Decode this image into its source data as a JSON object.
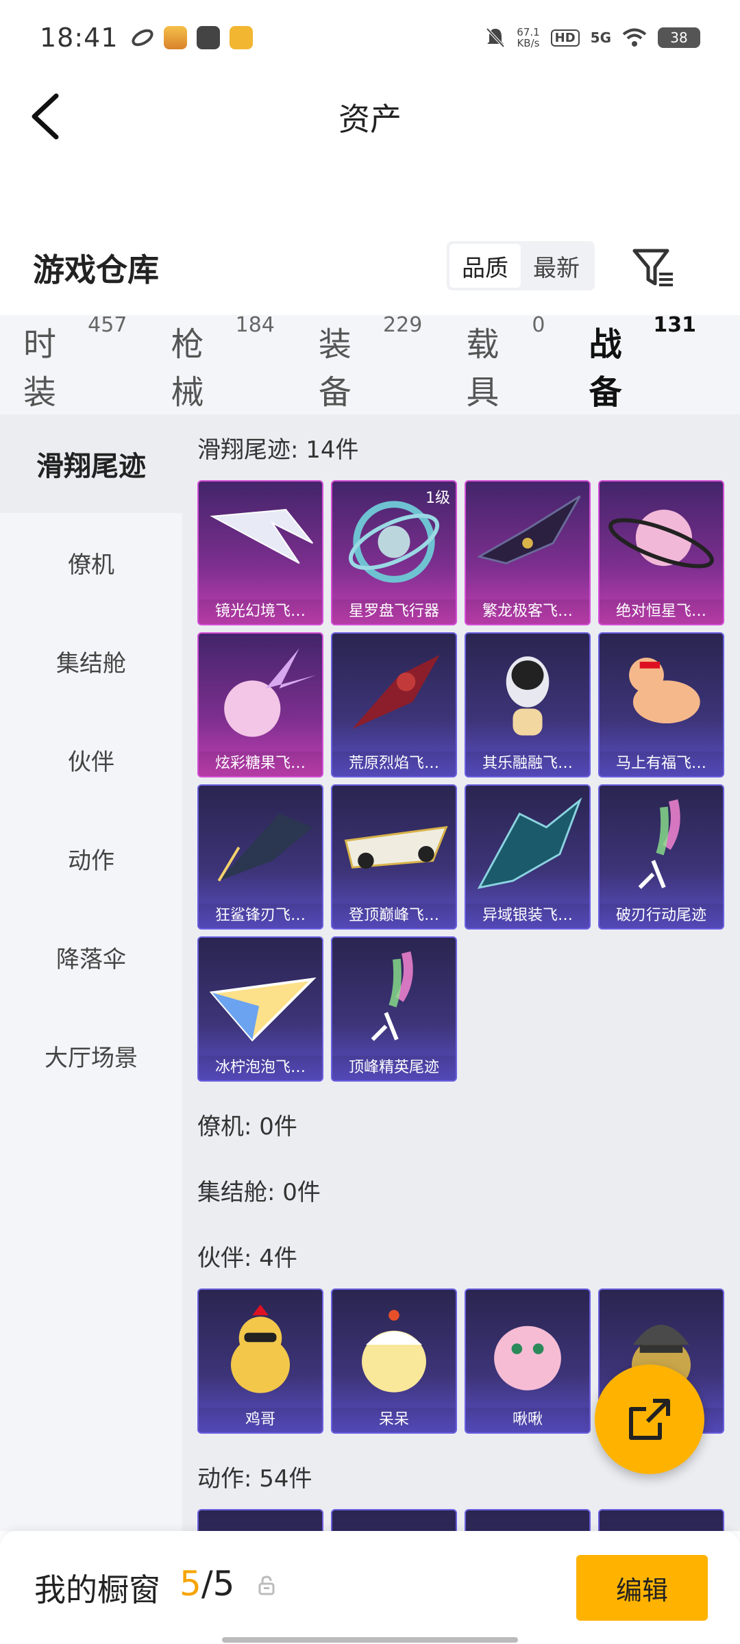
{
  "status": {
    "time": "18:41",
    "net_speed_value": "67.1",
    "net_speed_unit": "KB/s",
    "hd": "HD",
    "signal": "5G",
    "battery": "38"
  },
  "header": {
    "title": "资产"
  },
  "warehouse": {
    "title": "游戏仓库",
    "sort": {
      "quality": "品质",
      "newest": "最新",
      "active": "quality"
    }
  },
  "tabs": [
    {
      "label": "时装",
      "count": "457"
    },
    {
      "label": "枪械",
      "count": "184"
    },
    {
      "label": "装备",
      "count": "229"
    },
    {
      "label": "载具",
      "count": "0"
    },
    {
      "label": "战备",
      "count": "131",
      "active": true
    }
  ],
  "sidebar": {
    "items": [
      "滑翔尾迹",
      "僚机",
      "集结舱",
      "伙伴",
      "动作",
      "降落伞",
      "大厅场景"
    ],
    "active_index": 0
  },
  "sections": {
    "glide": {
      "title": "滑翔尾迹: 14件",
      "items": [
        {
          "name": "镜光幻境飞…",
          "tier": "pink",
          "icon": "crystal-wings-icon"
        },
        {
          "name": "星罗盘飞行器",
          "tier": "pink",
          "icon": "astrolabe-icon",
          "level": "1级"
        },
        {
          "name": "繁龙极客飞…",
          "tier": "pink",
          "icon": "dragon-glider-icon"
        },
        {
          "name": "绝对恒星飞…",
          "tier": "pink",
          "icon": "planet-icon"
        },
        {
          "name": "炫彩糖果飞…",
          "tier": "pink",
          "icon": "candy-icon"
        },
        {
          "name": "荒原烈焰飞…",
          "tier": "purple",
          "icon": "flame-glider-icon"
        },
        {
          "name": "其乐融融飞…",
          "tier": "purple",
          "icon": "penguin-icon"
        },
        {
          "name": "马上有福飞…",
          "tier": "purple",
          "icon": "horse-icon"
        },
        {
          "name": "狂鲨锋刃飞…",
          "tier": "purple",
          "icon": "shark-icon"
        },
        {
          "name": "登顶巅峰飞…",
          "tier": "purple",
          "icon": "jet-icon"
        },
        {
          "name": "异域银装飞…",
          "tier": "purple",
          "icon": "bat-wing-icon"
        },
        {
          "name": "破刃行动尾迹",
          "tier": "purple",
          "icon": "smoke-trail-icon"
        },
        {
          "name": "冰柠泡泡飞…",
          "tier": "purple",
          "icon": "paper-plane-icon"
        },
        {
          "name": "顶峰精英尾迹",
          "tier": "purple",
          "icon": "smoke-trail-icon"
        }
      ]
    },
    "wingman": {
      "title": "僚机: 0件"
    },
    "capsule": {
      "title": "集结舱: 0件"
    },
    "partner": {
      "title": "伙伴: 4件",
      "items": [
        {
          "name": "鸡哥",
          "tier": "purple",
          "icon": "rooster-icon"
        },
        {
          "name": "呆呆",
          "tier": "purple",
          "icon": "chick-icon"
        },
        {
          "name": "啾啾",
          "tier": "purple",
          "icon": "pink-bird-icon"
        },
        {
          "name": "",
          "tier": "purple",
          "icon": "helmet-chick-icon"
        }
      ]
    },
    "emote": {
      "title": "动作: 54件"
    }
  },
  "showcase": {
    "label": "我的橱窗",
    "current": "5",
    "separator": "/",
    "total": "5",
    "edit_label": "编辑"
  },
  "colors": {
    "accent": "#ffb300",
    "pink_tier": "#c540b3",
    "purple_tier": "#5a4fc7"
  }
}
